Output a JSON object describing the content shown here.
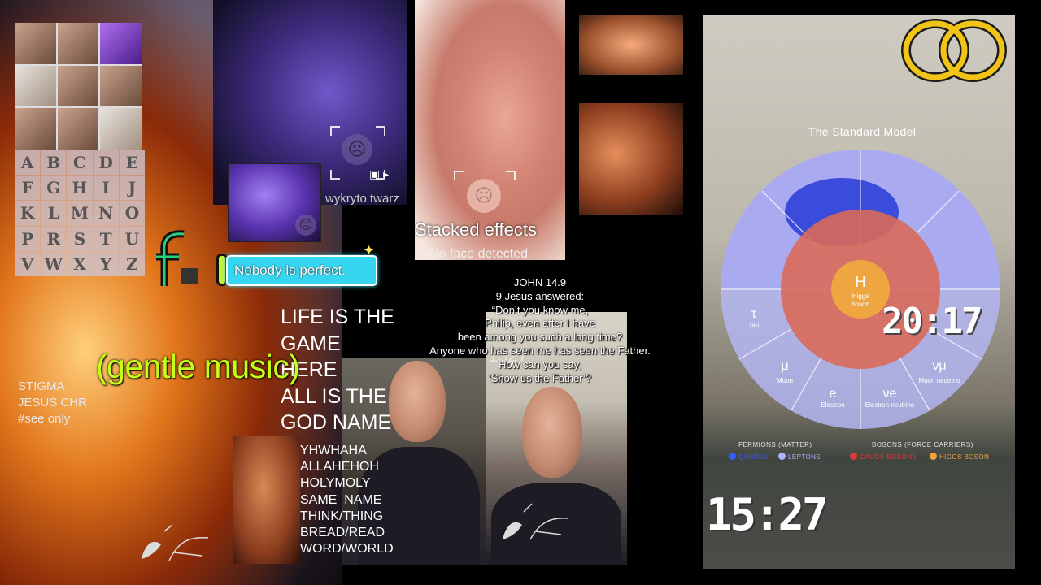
{
  "left_letters": [
    "A",
    "B",
    "C",
    "D",
    "E",
    "F",
    "G",
    "H",
    "I",
    "J",
    "K",
    "L",
    "M",
    "N",
    "O",
    "P",
    "R",
    "S",
    "T",
    "U",
    "V",
    "W",
    "X",
    "Y",
    "Z"
  ],
  "left_caption": [
    "STIGMA",
    "JESUS CHR",
    "#see only"
  ],
  "gentle_music": "(gentle music)",
  "face_overlay_text": "wykryto twarz",
  "sticker_text": "Nobody is perfect.",
  "effects": {
    "title": "Stacked effects",
    "subtitle": "No face detected"
  },
  "verse": [
    "JOHN 14.9",
    "9 Jesus answered:",
    "“Don’t you know me,",
    "Philip, even after I have",
    "been among you such a long time?",
    "Anyone who has seen me has seen the Father.",
    "How can you say,",
    "‘Show us the Father’?"
  ],
  "life_text": [
    "LIFE IS THE",
    "GAME",
    "HERE",
    "ALL IS THE",
    "GOD NAME"
  ],
  "words_list": [
    "YHWHAHA",
    "ALLAHEHOH",
    "HOLYMOLY",
    "SAME  NAME",
    "THINK/THING",
    "BREAD/READ",
    "WORD/WORLD"
  ],
  "overlay_numbers": "1527",
  "standard_model": {
    "title": "The Standard Model",
    "center": [
      "H",
      "Higgs",
      "boson"
    ],
    "particles": [
      {
        "symbol": "τ",
        "name": "Tau"
      },
      {
        "symbol": "μ",
        "name": "Muon"
      },
      {
        "symbol": "e",
        "name": "Electron"
      },
      {
        "symbol": "νe",
        "name": "Electron neutrino"
      },
      {
        "symbol": "νμ",
        "name": "Muon neutrino"
      }
    ],
    "fermions_label": "FERMIONS (MATTER)",
    "bosons_label": "BOSONS (FORCE CARRIERS)",
    "legend": [
      "QUARKS",
      "LEPTONS",
      "GAUGE BOSONS",
      "HIGGS BOSON"
    ],
    "colors": {
      "quarks": "#3b5bff",
      "leptons": "#a9b3ff",
      "gauge": "#e2383a",
      "higgs": "#f2a23a"
    }
  },
  "clock_small": "20:17",
  "clock_large": "15:27"
}
